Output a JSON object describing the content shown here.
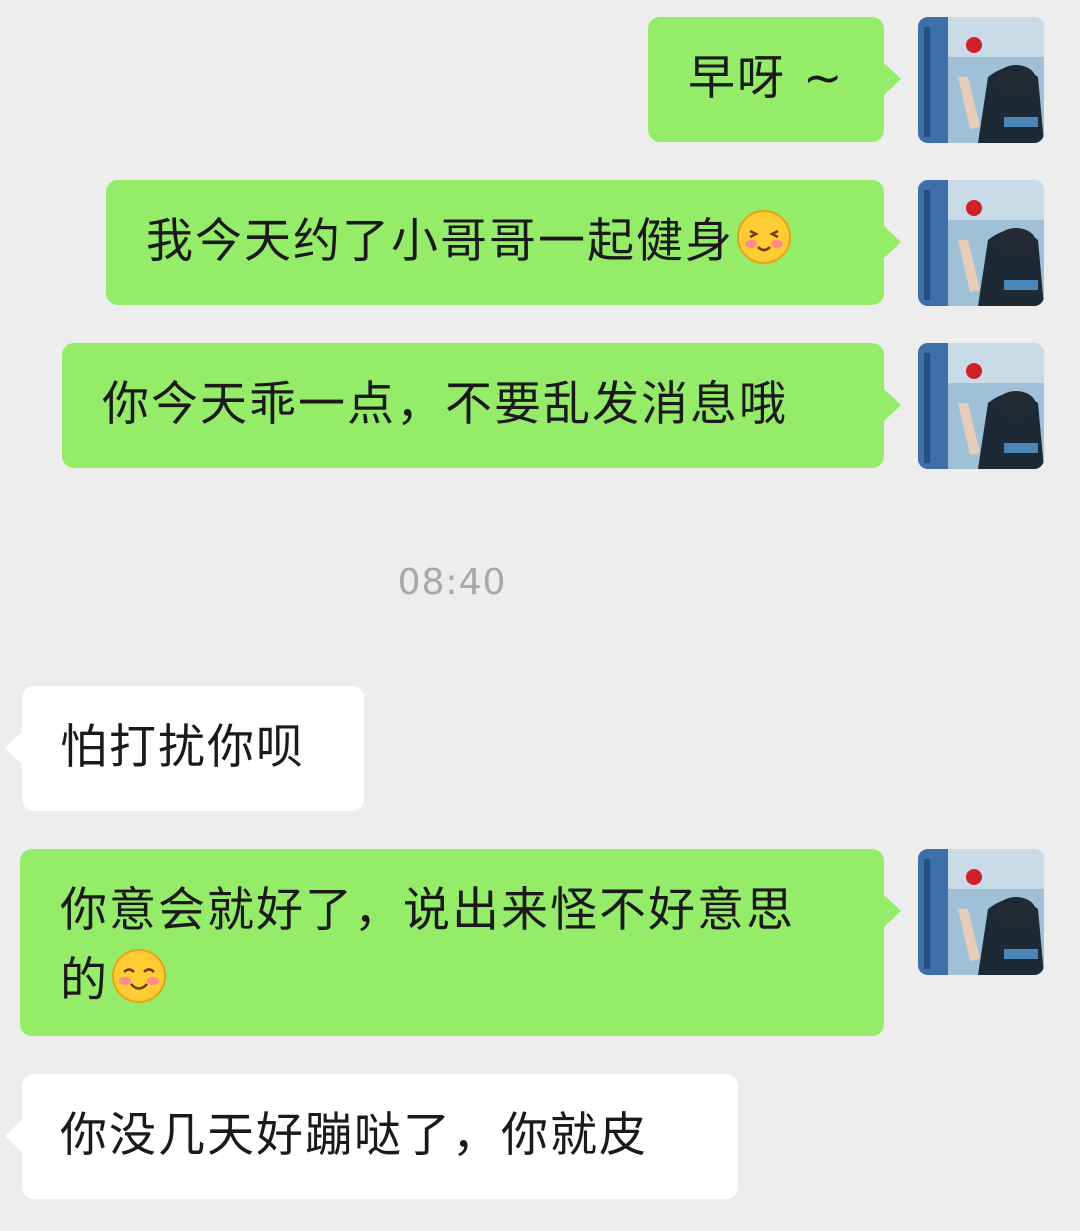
{
  "chat": {
    "timestamp": "08:40",
    "messages": [
      {
        "sender": "me",
        "text": "早呀 ~"
      },
      {
        "sender": "me",
        "text": "我今天约了小哥哥一起健身",
        "emoji": "shy-smiling-face-emoji"
      },
      {
        "sender": "me",
        "text": "你今天乖一点，不要乱发消息哦"
      },
      {
        "sender": "other",
        "text": "怕打扰你呗"
      },
      {
        "sender": "me",
        "line1": "你意会就好了，说出来怪不好意思",
        "line2": "的",
        "emoji": "smiling-blush-face-emoji"
      },
      {
        "sender": "other",
        "text": "你没几天好蹦哒了，你就皮"
      }
    ]
  },
  "colors": {
    "background": "#ededed",
    "my_bubble": "#95ec69",
    "other_bubble": "#ffffff",
    "timestamp_text": "#a8a8a8"
  },
  "icons": {
    "avatar": "user-avatar-photo"
  }
}
